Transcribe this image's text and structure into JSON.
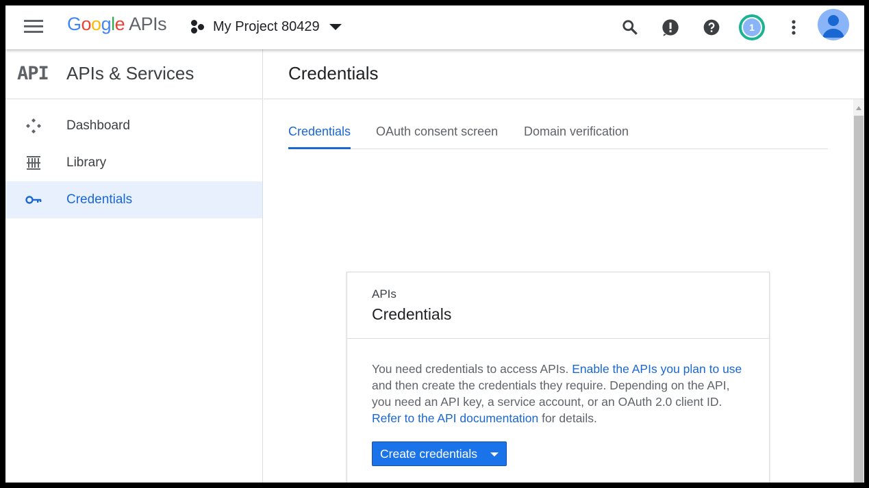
{
  "colors": {
    "accent": "#1967d2",
    "active_nav_bg": "#e8f0fe",
    "button_bg": "#1a73e8",
    "notification_ring": "#1ab394"
  },
  "topbar": {
    "menu_icon": "hamburger-menu-icon",
    "logo": {
      "g": "G",
      "o1": "o",
      "o2": "o",
      "g2": "g",
      "l": "l",
      "e": "e",
      "apis": "APIs"
    },
    "project": {
      "icon": "project-nodes-icon",
      "name": "My Project 80429",
      "caret": "caret-down-icon"
    },
    "icons": [
      "search-icon",
      "feedback-icon",
      "help-icon",
      "notifications-icon",
      "more-vert-icon"
    ],
    "notifications_count": "1",
    "avatar": "account-avatar"
  },
  "sidebar": {
    "logo": "API",
    "title": "APIs & Services",
    "items": [
      {
        "label": "Dashboard",
        "icon": "dashboard-icon",
        "active": false
      },
      {
        "label": "Library",
        "icon": "library-icon",
        "active": false
      },
      {
        "label": "Credentials",
        "icon": "key-icon",
        "active": true
      }
    ]
  },
  "main": {
    "title": "Credentials",
    "tabs": [
      {
        "label": "Credentials",
        "active": true
      },
      {
        "label": "OAuth consent screen",
        "active": false
      },
      {
        "label": "Domain verification",
        "active": false
      }
    ],
    "card": {
      "kicker": "APIs",
      "title": "Credentials",
      "body": {
        "t1": "You need credentials to access APIs. ",
        "link1": "Enable the APIs you plan to use",
        "t2": " and then create the credentials they require. Depending on the API, you need an API key, a service account, or an OAuth 2.0 client ID. ",
        "link2": "Refer to the API documentation",
        "t3": " for details."
      },
      "button_label": "Create credentials"
    }
  }
}
